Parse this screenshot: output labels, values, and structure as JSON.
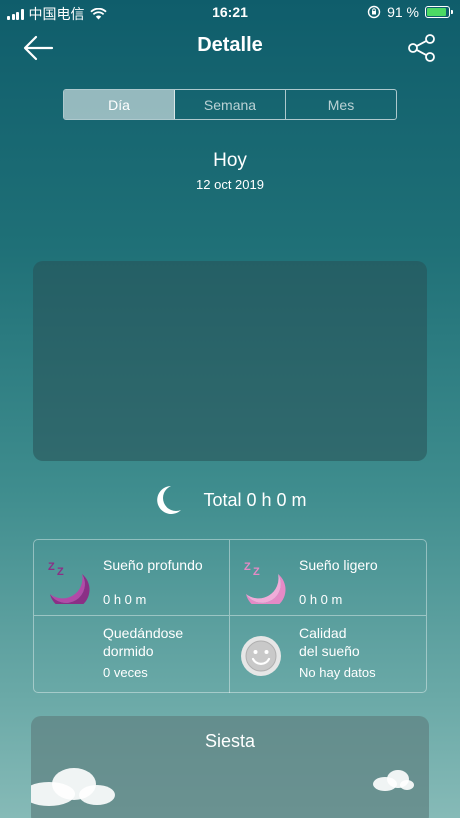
{
  "status": {
    "carrier": "中国电信",
    "time": "16:21",
    "battery_percent": "91 %",
    "battery_level": 0.91
  },
  "nav": {
    "title": "Detalle",
    "back_icon": "arrow-left-icon",
    "share_icon": "share-icon"
  },
  "tabs": [
    {
      "label": "Día",
      "active": true
    },
    {
      "label": "Semana",
      "active": false
    },
    {
      "label": "Mes",
      "active": false
    }
  ],
  "day": {
    "title": "Hoy",
    "date": "12 oct 2019"
  },
  "total": {
    "icon": "moon-icon",
    "text": "Total 0 h 0 m"
  },
  "stats": [
    {
      "label": "Sueño profundo",
      "value": "0 h 0 m",
      "icon": "deep-sleep-moon-icon",
      "color": "#8b2f86"
    },
    {
      "label": "Sueño ligero",
      "value": "0 h 0 m",
      "icon": "light-sleep-moon-icon",
      "color": "#e58ac6"
    },
    {
      "label": "Quedándose\ndormido",
      "value": "0 veces",
      "icon": "falling-asleep-moon-icon",
      "color": "#8e8fe6"
    },
    {
      "label": "Calidad\ndel sueño",
      "value": "No hay datos",
      "icon": "smiley-face-icon",
      "color": "#c9c9c9"
    }
  ],
  "nap": {
    "title": "Siesta"
  }
}
